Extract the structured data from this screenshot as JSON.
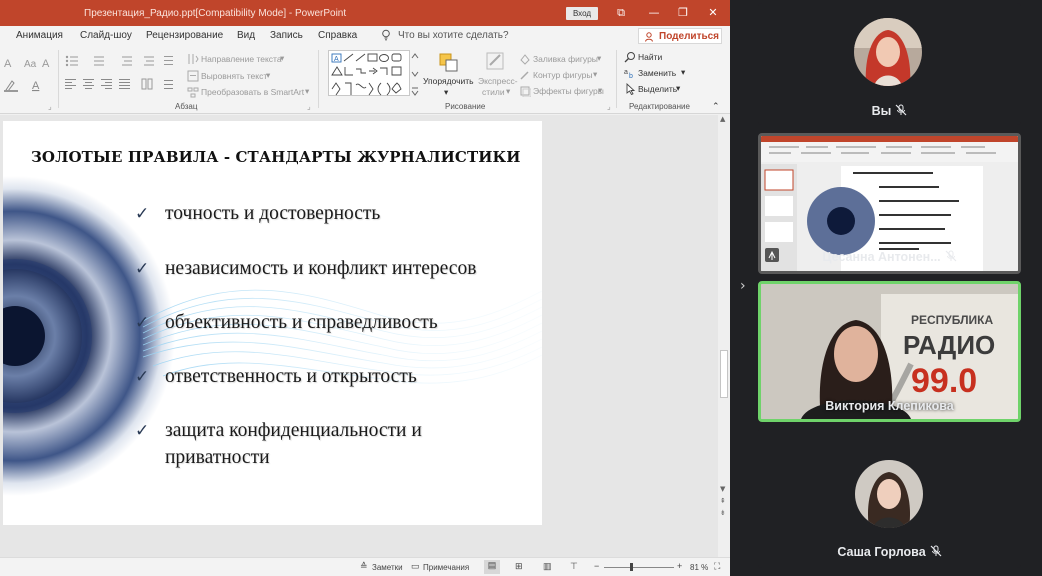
{
  "window": {
    "title": "Презентация_Радио.ppt[Compatibility Mode]  -  PowerPoint",
    "signin_label": "Вход",
    "controls": [
      "⧉",
      "—",
      "❐",
      "✕"
    ]
  },
  "menu": {
    "items": [
      "Анимация",
      "Слайд-шоу",
      "Рецензирование",
      "Вид",
      "Запись",
      "Справка"
    ],
    "tell_me": "Что вы хотите сделать?",
    "share_label": "Поделиться"
  },
  "ribbon": {
    "paragraph": {
      "text_direction": "Направление текста",
      "align_text": "Выровнять текст",
      "convert_smartart": "Преобразовать в SmartArt",
      "group_label": "Абзац"
    },
    "drawing": {
      "arrange": "Упорядочить",
      "quick_styles_1": "Экспресс-",
      "quick_styles_2": "стили",
      "shape_fill": "Заливка фигуры",
      "shape_outline": "Контур фигуры",
      "shape_effects": "Эффекты фигуры",
      "group_label": "Рисование"
    },
    "editing": {
      "find": "Найти",
      "replace": "Заменить",
      "select": "Выделить",
      "group_label": "Редактирование"
    }
  },
  "slide": {
    "title": "ЗОЛОТЫЕ ПРАВИЛА - СТАНДАРТЫ ЖУРНАЛИСТИКИ",
    "bullets": [
      "точность и достоверность",
      "независимость и конфликт интересов",
      "объективность и справедливость",
      "ответственность и открытость",
      "защита конфиденциальности и",
      "приватности"
    ]
  },
  "status": {
    "notes_label": "Заметки",
    "comments_label": "Примечания",
    "zoom": "81 %"
  },
  "participants": {
    "you": "Вы",
    "p2": "Цесанна Антонен...",
    "p3": "Виктория Клепикова",
    "p4": "Саша Горлова"
  },
  "colors": {
    "ppt_accent": "#c0452b",
    "speaking_border": "#6fd36a",
    "tile_bg": "#3c4043"
  }
}
